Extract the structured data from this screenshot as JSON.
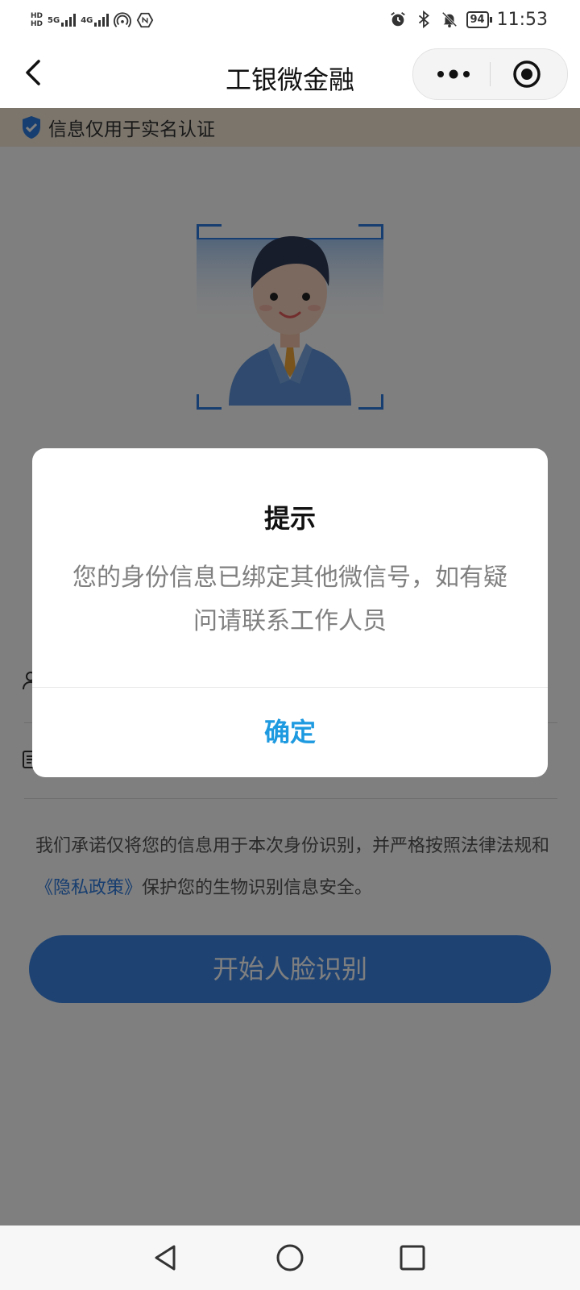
{
  "status_bar": {
    "sim1": "HD",
    "sim2": "HD",
    "network1": "5G",
    "network2": "4G",
    "battery": "94",
    "time": "11:53",
    "icons": [
      "alarm-icon",
      "bluetooth-icon",
      "mute-icon",
      "battery-icon"
    ]
  },
  "nav": {
    "title": "工银微金融",
    "back_icon": "chevron-left-icon",
    "more_icon": "more-dots-icon",
    "close_icon": "target-icon"
  },
  "notice": {
    "text": "信息仅用于实名认证",
    "icon": "shield-check-icon"
  },
  "privacy": {
    "text_before": "我们承诺仅将您的信息用于本次身份识别，并严格按照法律法规和",
    "link": "《隐私政策》",
    "text_after": "保护您的生物识别信息安全。"
  },
  "start_button": "开始人脸识别",
  "dialog": {
    "title": "提示",
    "message": "您的身份信息已绑定其他微信号，如有疑问请联系工作人员",
    "confirm": "确定"
  },
  "colors": {
    "accent": "#2f7de0",
    "dialog_button": "#1e9ae0",
    "notice_bg": "#f6ead8"
  }
}
